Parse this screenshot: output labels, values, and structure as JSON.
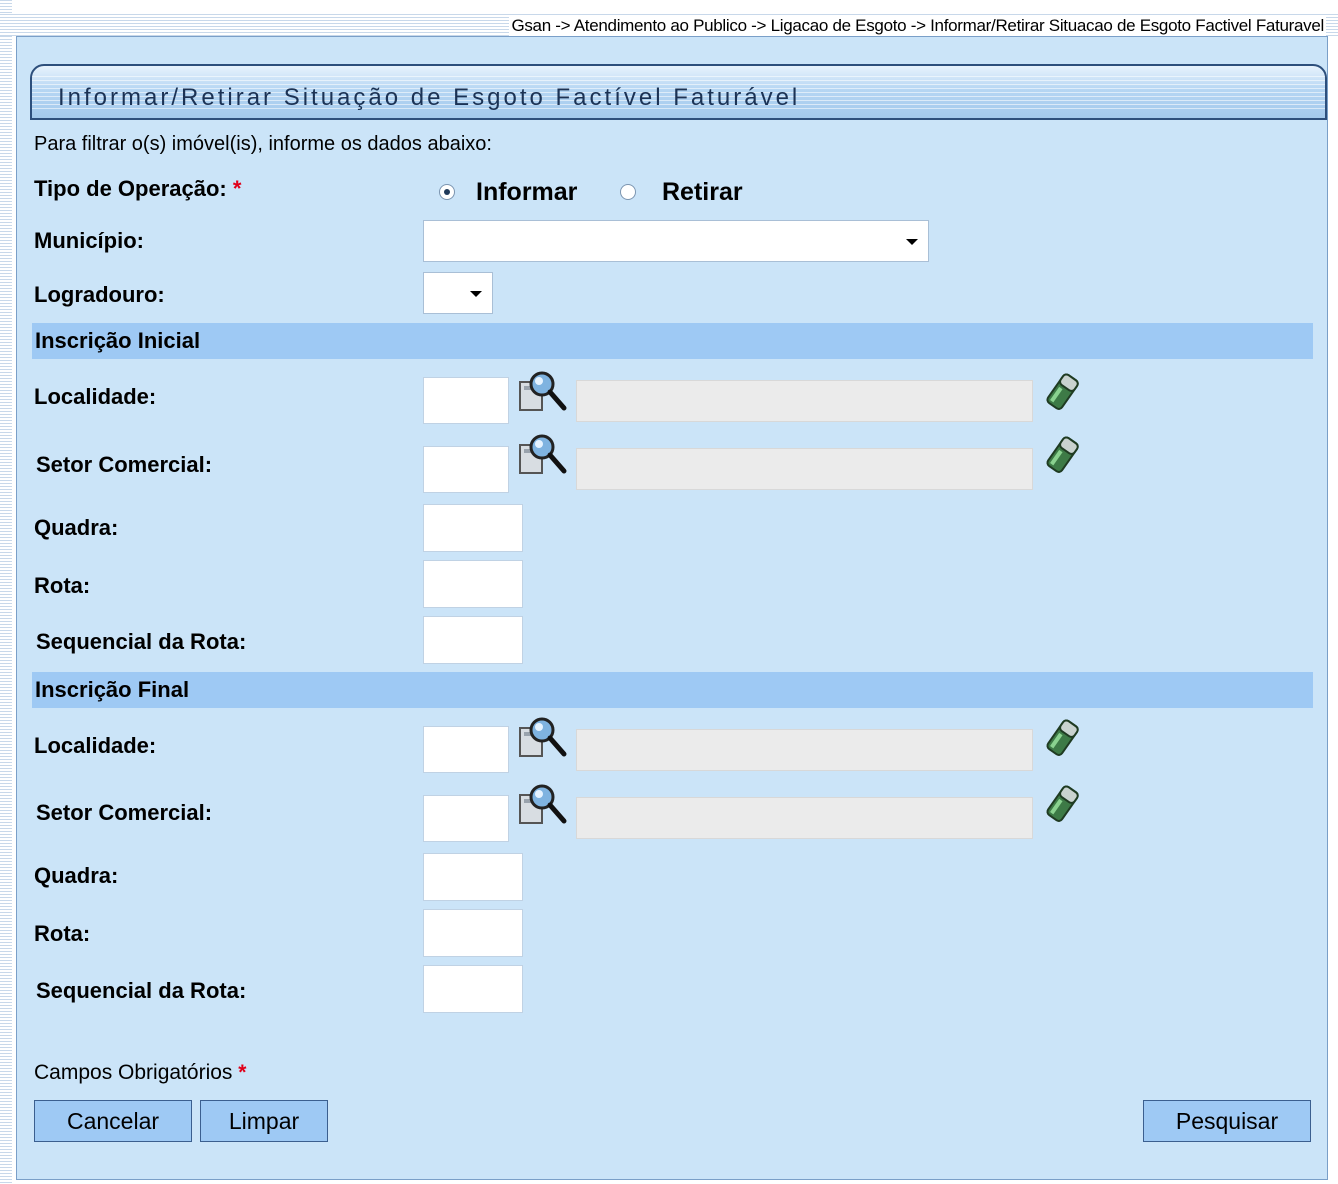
{
  "breadcrumb": "Gsan -> Atendimento ao Publico -> Ligacao de Esgoto -> Informar/Retirar Situacao de Esgoto Factivel Faturavel",
  "title": "Informar/Retirar Situação de Esgoto Factível Faturável",
  "intro": "Para filtrar o(s) imóvel(is), informe os dados abaixo:",
  "tipo_operacao": {
    "label": "Tipo de Operação:",
    "required_mark": "*",
    "options": [
      {
        "label": "Informar",
        "checked": true
      },
      {
        "label": "Retirar",
        "checked": false
      }
    ]
  },
  "municipio": {
    "label": "Município:",
    "value": ""
  },
  "logradouro": {
    "label": "Logradouro:",
    "value": ""
  },
  "inscricao_inicial": {
    "header": "Inscrição Inicial",
    "localidade_label": "Localidade:",
    "localidade_code": "",
    "localidade_desc": "",
    "setor_label": "Setor Comercial:",
    "setor_code": "",
    "setor_desc": "",
    "quadra_label": "Quadra:",
    "quadra_value": "",
    "rota_label": "Rota:",
    "rota_value": "",
    "sequencial_label": "Sequencial da Rota:",
    "sequencial_value": ""
  },
  "inscricao_final": {
    "header": "Inscrição Final",
    "localidade_label": "Localidade:",
    "localidade_code": "",
    "localidade_desc": "",
    "setor_label": "Setor Comercial:",
    "setor_code": "",
    "setor_desc": "",
    "quadra_label": "Quadra:",
    "quadra_value": "",
    "rota_label": "Rota:",
    "rota_value": "",
    "sequencial_label": "Sequencial da Rota:",
    "sequencial_value": ""
  },
  "required_note": {
    "text": "Campos Obrigatórios",
    "mark": "*"
  },
  "buttons": {
    "cancelar": "Cancelar",
    "limpar": "Limpar",
    "pesquisar": "Pesquisar"
  },
  "icons": {
    "search": "magnifier-icon",
    "clear": "eraser-icon"
  },
  "colors": {
    "panel": "#cbe4f8",
    "section_header": "#9ec9f4",
    "title_text": "#1b3254",
    "required": "#e0001a"
  }
}
